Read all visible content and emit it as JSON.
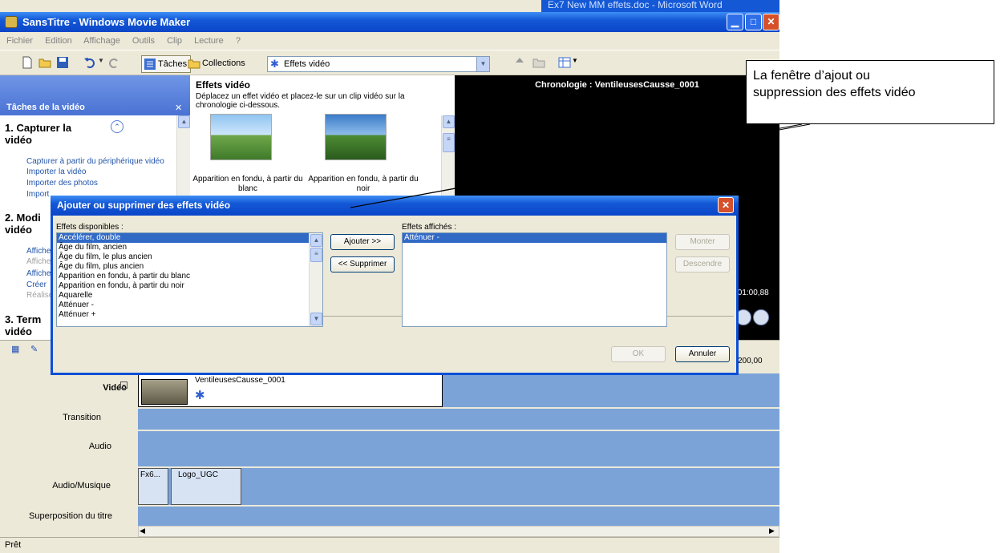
{
  "window": {
    "title": "SansTitre - Windows Movie Maker",
    "background_doc_title": "Ex7 New MM effets.doc - Microsoft Word"
  },
  "menu": [
    "Fichier",
    "Edition",
    "Affichage",
    "Outils",
    "Clip",
    "Lecture",
    "?"
  ],
  "toolbar": {
    "tasks_label": "Tâches",
    "collections_label": "Collections",
    "collection_value": "Effets vidéo"
  },
  "task_pane": {
    "title": "Tâches de la vidéo",
    "section1": {
      "heading": "1. Capturer la vidéo",
      "links": [
        "Capturer à partir du périphérique vidéo",
        "Importer la vidéo",
        "Importer des photos",
        "Import"
      ]
    },
    "section2": {
      "heading": "2. Modi vidéo",
      "links": [
        "Affiche",
        "Affiche",
        "Affiche",
        "Créer",
        "Réalise"
      ]
    },
    "section3": {
      "heading": "3. Term vidéo"
    }
  },
  "content": {
    "title": "Effets vidéo",
    "description": "Déplacez un effet vidéo et placez-le sur un clip vidéo sur la chronologie ci-dessous.",
    "effects": [
      "Apparition en fondu, à partir du blanc",
      "Apparition en fondu, à partir du noir"
    ]
  },
  "preview": {
    "title": "Chronologie : VentileusesCausse_0001",
    "time": ":01:00,88"
  },
  "timeline": {
    "ruler_time": "200,00",
    "tracks": [
      "Vidéo",
      "Transition",
      "Audio",
      "Audio/Musique",
      "Superposition du titre"
    ],
    "video_clip": "VentileusesCausse_0001",
    "audio_clips": [
      "Fx6...",
      "Logo_UGC"
    ]
  },
  "dialog": {
    "title": "Ajouter ou supprimer des effets vidéo",
    "available_label": "Effets disponibles :",
    "available": [
      "Accélérer, double",
      "Âge du film, ancien",
      "Âge du film, le plus ancien",
      "Âge du film, plus ancien",
      "Apparition en fondu, à partir du blanc",
      "Apparition en fondu, à partir du noir",
      "Aquarelle",
      "Atténuer -",
      "Atténuer +"
    ],
    "displayed_label": "Effets affichés :",
    "displayed": [
      "Atténuer -"
    ],
    "add_label": "Ajouter >>",
    "remove_label": "<< Supprimer",
    "up_label": "Monter",
    "down_label": "Descendre",
    "ok_label": "OK",
    "cancel_label": "Annuler"
  },
  "status": "Prêt",
  "callout": {
    "line1": "La fenêtre d’ajout ou",
    "line2": "suppression des effets vidéo"
  }
}
